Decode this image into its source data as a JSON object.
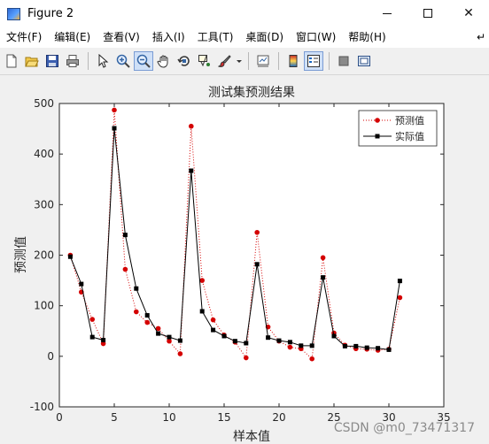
{
  "window": {
    "title": "Figure 2",
    "minimize_label": "minimize",
    "maximize_label": "maximize",
    "close_label": "close",
    "close_glyph": "✕"
  },
  "menu": {
    "items": [
      "文件(F)",
      "编辑(E)",
      "查看(V)",
      "插入(I)",
      "工具(T)",
      "桌面(D)",
      "窗口(W)",
      "帮助(H)"
    ],
    "overflow": "↵"
  },
  "toolbar": {
    "icons": [
      "new-figure-icon",
      "open-file-icon",
      "save-icon",
      "print-icon",
      "select-pointer-icon",
      "zoom-in-icon",
      "zoom-out-icon",
      "pan-hand-icon",
      "rotate-3d-icon",
      "data-cursor-icon",
      "brush-icon",
      "link-plot-icon",
      "colorbar-icon",
      "legend-icon",
      "hide-plot-tools-icon",
      "show-plot-tools-icon"
    ]
  },
  "chart_data": {
    "type": "line",
    "title": "测试集预测结果",
    "xlabel": "样本值",
    "ylabel": "预测值",
    "xlim": [
      0,
      35
    ],
    "ylim": [
      -100,
      500
    ],
    "xticks": [
      0,
      5,
      10,
      15,
      20,
      25,
      30,
      35
    ],
    "yticks": [
      -100,
      0,
      100,
      200,
      300,
      400,
      500
    ],
    "grid": false,
    "legend_position": "top-right",
    "x": [
      1,
      2,
      3,
      4,
      5,
      6,
      7,
      8,
      9,
      10,
      11,
      12,
      13,
      14,
      15,
      16,
      17,
      18,
      19,
      20,
      21,
      22,
      23,
      24,
      25,
      26,
      27,
      28,
      29,
      30,
      31
    ],
    "series": [
      {
        "name": "预测值",
        "style": "dotted",
        "marker": "circle",
        "color": "#d40000",
        "values": [
          200,
          127,
          73,
          25,
          487,
          172,
          88,
          67,
          55,
          30,
          5,
          455,
          150,
          72,
          42,
          28,
          -3,
          245,
          58,
          30,
          18,
          15,
          -5,
          195,
          46,
          22,
          15,
          14,
          12,
          14,
          116
        ]
      },
      {
        "name": "实际值",
        "style": "solid",
        "marker": "square",
        "color": "#000000",
        "values": [
          197,
          143,
          38,
          32,
          451,
          240,
          134,
          81,
          45,
          38,
          31,
          367,
          89,
          52,
          40,
          30,
          26,
          182,
          37,
          31,
          28,
          21,
          21,
          156,
          40,
          20,
          20,
          17,
          16,
          13,
          149
        ]
      }
    ]
  },
  "watermark": "CSDN @m0_73471317"
}
